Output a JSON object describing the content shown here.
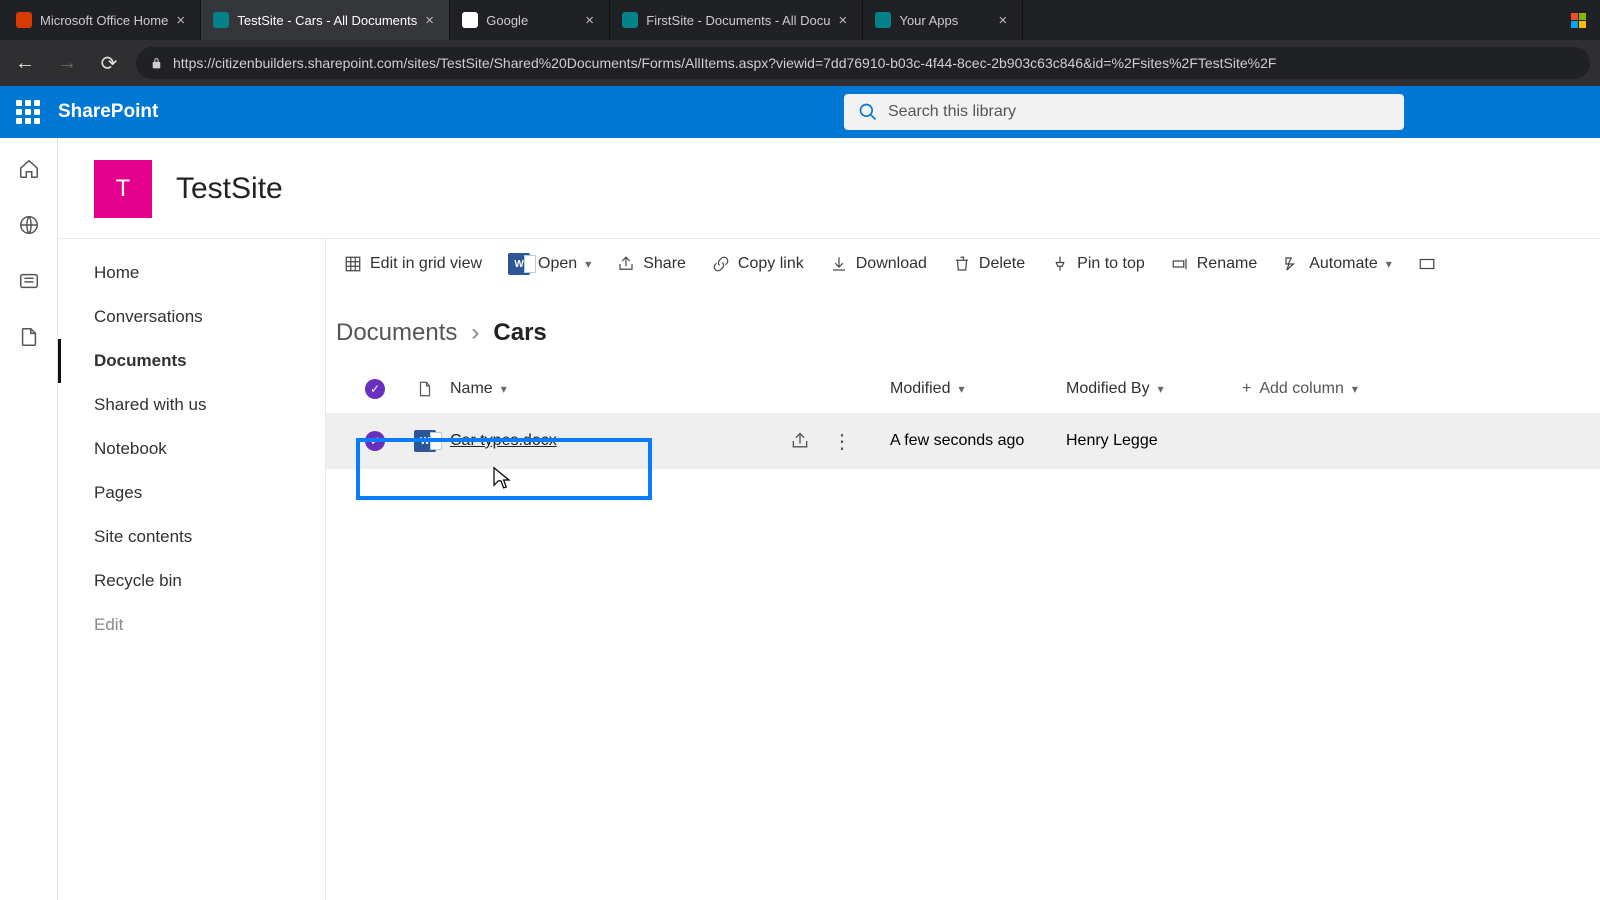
{
  "browser": {
    "tabs": [
      {
        "title": "Microsoft Office Home",
        "favicon": "#d83b01"
      },
      {
        "title": "TestSite - Cars - All Documents",
        "favicon": "#038387",
        "active": true
      },
      {
        "title": "Google",
        "favicon": "#ffffff"
      },
      {
        "title": "FirstSite - Documents - All Docu",
        "favicon": "#038387"
      },
      {
        "title": "Your Apps",
        "favicon": "#038387"
      }
    ],
    "url": "https://citizenbuilders.sharepoint.com/sites/TestSite/Shared%20Documents/Forms/AllItems.aspx?viewid=7dd76910-b03c-4f44-8cec-2b903c63c846&id=%2Fsites%2FTestSite%2F"
  },
  "sharepoint": {
    "app_name": "SharePoint",
    "search_placeholder": "Search this library",
    "site": {
      "logo_letter": "T",
      "title": "TestSite"
    },
    "leftnav": {
      "items": [
        {
          "label": "Home"
        },
        {
          "label": "Conversations"
        },
        {
          "label": "Documents",
          "active": true
        },
        {
          "label": "Shared with us"
        },
        {
          "label": "Notebook"
        },
        {
          "label": "Pages"
        },
        {
          "label": "Site contents"
        },
        {
          "label": "Recycle bin"
        },
        {
          "label": "Edit",
          "muted": true
        }
      ]
    },
    "commandbar": {
      "edit_grid": "Edit in grid view",
      "open": "Open",
      "share": "Share",
      "copy_link": "Copy link",
      "download": "Download",
      "delete": "Delete",
      "pin": "Pin to top",
      "rename": "Rename",
      "automate": "Automate"
    },
    "breadcrumbs": {
      "root": "Documents",
      "current": "Cars"
    },
    "columns": {
      "name": "Name",
      "modified": "Modified",
      "modified_by": "Modified By",
      "add": "Add column"
    },
    "rows": [
      {
        "name": "Car types.docx",
        "modified": "A few seconds ago",
        "modified_by": "Henry Legge",
        "selected": true
      }
    ]
  }
}
